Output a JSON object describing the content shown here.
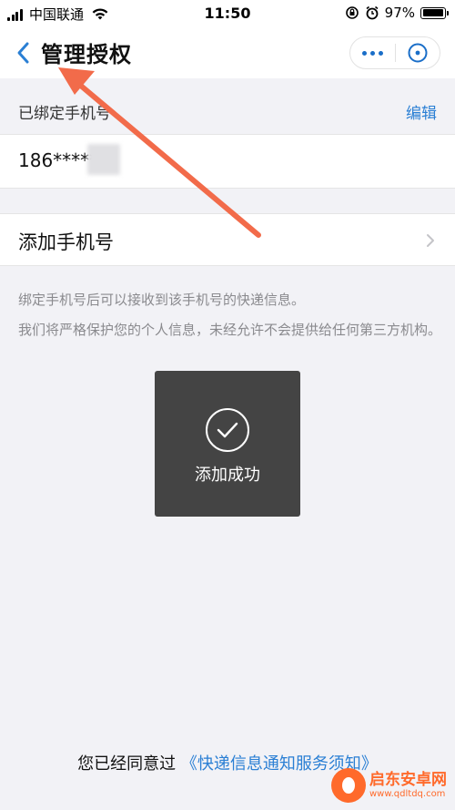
{
  "status_bar": {
    "carrier": "中国联通",
    "time": "11:50",
    "battery_percent": "97%",
    "battery_level": 0.97
  },
  "nav": {
    "title": "管理授权"
  },
  "bound_section": {
    "header": "已绑定手机号",
    "edit_label": "编辑",
    "phone_masked": "186*****"
  },
  "add_row": {
    "label": "添加手机号"
  },
  "notes": [
    "绑定手机号后可以接收到该手机号的快递信息。",
    "我们将严格保护您的个人信息，未经允许不会提供给任何第三方机构。"
  ],
  "toast": {
    "message": "添加成功"
  },
  "footer": {
    "prefix": "您已经同意过",
    "link": "《快递信息通知服务须知》"
  },
  "watermark": {
    "name": "启东安卓网",
    "url": "www.qdltdq.com"
  },
  "colors": {
    "accent_blue": "#2a7fd4",
    "annotation_arrow": "#f26b4a",
    "toast_bg": "#404040",
    "page_bg": "#f2f2f6"
  }
}
